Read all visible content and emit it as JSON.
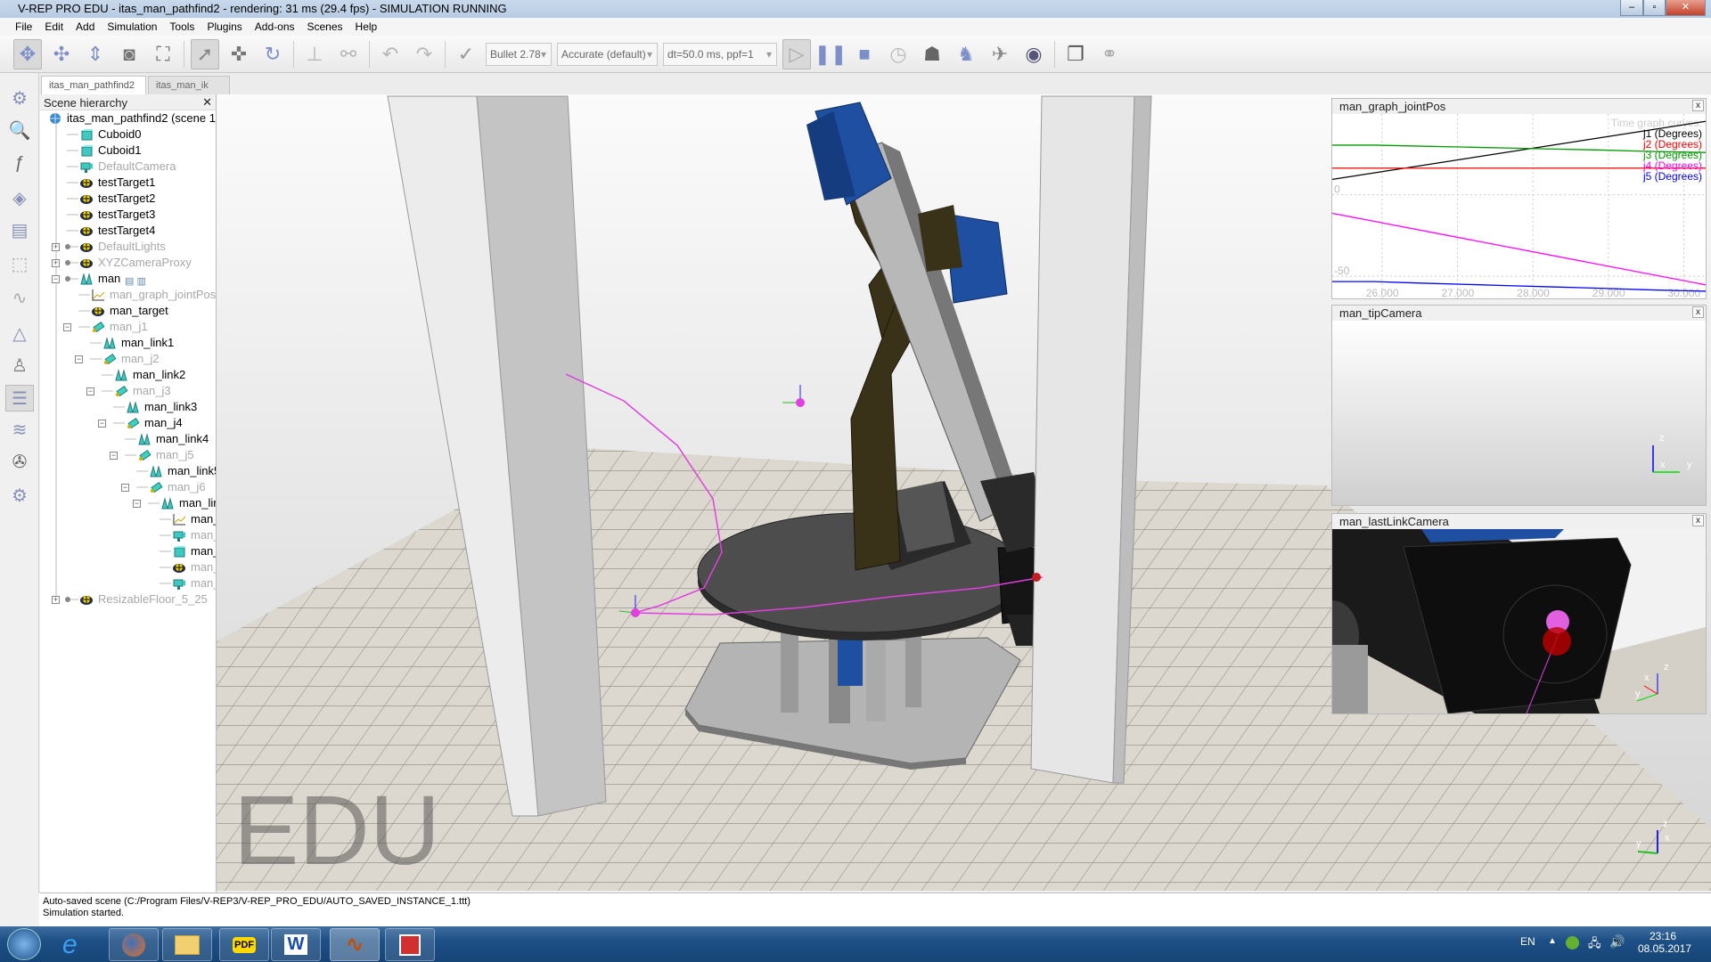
{
  "window": {
    "title": "V-REP PRO EDU - itas_man_pathfind2 - rendering: 31 ms (29.4 fps) - SIMULATION RUNNING",
    "min": "–",
    "max": "▫",
    "close": "✕"
  },
  "menu": [
    "File",
    "Edit",
    "Add",
    "Simulation",
    "Tools",
    "Plugins",
    "Add-ons",
    "Scenes",
    "Help"
  ],
  "toolbar": {
    "engine": "Bullet 2.78",
    "accuracy": "Accurate (default)",
    "timestep": "dt=50.0 ms, ppf=1",
    "icons": [
      "move-camera-icon",
      "rotate-camera-icon",
      "shift-camera-icon",
      "camera-angle-icon",
      "fit-to-view-icon",
      "click-select-icon",
      "object-shift-icon",
      "object-rotate-icon",
      "assemble-icon",
      "transfer-dna-icon",
      "undo-icon",
      "redo-icon",
      "dynamics-engine-icon",
      "start-simulation-icon",
      "pause-simulation-icon",
      "stop-simulation-icon",
      "real-time-icon",
      "slower-icon",
      "faster-icon",
      "thread-rendering-icon",
      "visualization-icon",
      "page-selector-icon",
      "scene-selector-icon"
    ]
  },
  "tabs": [
    {
      "label": "itas_man_pathfind2",
      "active": true
    },
    {
      "label": "itas_man_ik",
      "active": false
    }
  ],
  "hierarchy": {
    "title": "Scene hierarchy",
    "close": "✕",
    "items": [
      {
        "label": "itas_man_pathfind2 (scene 1)",
        "level": 0,
        "icon": "scene",
        "gray": false
      },
      {
        "label": "Cuboid0",
        "level": 1,
        "icon": "cuboid",
        "gray": false
      },
      {
        "label": "Cuboid1",
        "level": 1,
        "icon": "cuboid",
        "gray": false
      },
      {
        "label": "DefaultCamera",
        "level": 1,
        "icon": "camera",
        "gray": true
      },
      {
        "label": "testTarget1",
        "level": 1,
        "icon": "dummy",
        "gray": false
      },
      {
        "label": "testTarget2",
        "level": 1,
        "icon": "dummy",
        "gray": false
      },
      {
        "label": "testTarget3",
        "level": 1,
        "icon": "dummy",
        "gray": false
      },
      {
        "label": "testTarget4",
        "level": 1,
        "icon": "dummy",
        "gray": false
      },
      {
        "label": "DefaultLights",
        "level": 1,
        "icon": "dummy",
        "gray": true,
        "expander": "+"
      },
      {
        "label": "XYZCameraProxy",
        "level": 1,
        "icon": "dummy",
        "gray": true,
        "expander": "+"
      },
      {
        "label": "man",
        "level": 1,
        "icon": "shape",
        "gray": false,
        "expander": "−",
        "extras": true
      },
      {
        "label": "man_graph_jointPos",
        "level": 2,
        "icon": "graph",
        "gray": true
      },
      {
        "label": "man_target",
        "level": 2,
        "icon": "dummy",
        "gray": false
      },
      {
        "label": "man_j1",
        "level": 2,
        "icon": "joint",
        "gray": true,
        "expander": "−"
      },
      {
        "label": "man_link1",
        "level": 3,
        "icon": "shape",
        "gray": false
      },
      {
        "label": "man_j2",
        "level": 3,
        "icon": "joint",
        "gray": true,
        "expander": "−"
      },
      {
        "label": "man_link2",
        "level": 4,
        "icon": "shape",
        "gray": false
      },
      {
        "label": "man_j3",
        "level": 4,
        "icon": "joint",
        "gray": true,
        "expander": "−"
      },
      {
        "label": "man_link3",
        "level": 5,
        "icon": "shape",
        "gray": false
      },
      {
        "label": "man_j4",
        "level": 5,
        "icon": "joint",
        "gray": false,
        "expander": "−"
      },
      {
        "label": "man_link4",
        "level": 6,
        "icon": "shape",
        "gray": false
      },
      {
        "label": "man_j5",
        "level": 6,
        "icon": "joint",
        "gray": true,
        "expander": "−"
      },
      {
        "label": "man_link5",
        "level": 7,
        "icon": "shape",
        "gray": false
      },
      {
        "label": "man_j6",
        "level": 7,
        "icon": "joint",
        "gray": true,
        "expander": "−"
      },
      {
        "label": "man_lin",
        "level": 8,
        "icon": "shape",
        "gray": false,
        "expander": "−"
      },
      {
        "label": "man_",
        "level": 9,
        "icon": "graph",
        "gray": false
      },
      {
        "label": "man_",
        "level": 9,
        "icon": "camera",
        "gray": true
      },
      {
        "label": "man_",
        "level": 9,
        "icon": "cuboid",
        "gray": false
      },
      {
        "label": "man_",
        "level": 9,
        "icon": "dummy",
        "gray": true
      },
      {
        "label": "man_",
        "level": 9,
        "icon": "camera",
        "gray": true
      },
      {
        "label": "ResizableFloor_5_25",
        "level": 1,
        "icon": "dummy",
        "gray": true,
        "expander": "+"
      }
    ]
  },
  "scene": {
    "watermark": "EDU"
  },
  "graph_panel": {
    "title": "man_graph_jointPos",
    "close": "x",
    "legend_title": "Time graph curves:"
  },
  "chart_data": {
    "type": "line",
    "xlim": [
      25.34,
      30.29
    ],
    "ylim": [
      -63.6,
      49.5
    ],
    "xticks": [
      "26.000",
      "27.000",
      "28.000",
      "29.000",
      "30.000"
    ],
    "xtick_values": [
      26,
      27,
      28,
      29,
      30
    ],
    "yticks": [
      "0",
      "-50"
    ],
    "ytick_values": [
      0,
      -50
    ],
    "grid": true,
    "legend_placement": "top-right",
    "series": [
      {
        "name": "j1 (Degrees)",
        "color": "#000000",
        "x": [
          25.34,
          30.29
        ],
        "y": [
          9.4,
          45.0
        ]
      },
      {
        "name": "j2 (Degrees)",
        "color": "#ff0000",
        "x": [
          25.34,
          30.29
        ],
        "y": [
          16.3,
          16.3
        ]
      },
      {
        "name": "j3 (Degrees)",
        "color": "#009900",
        "x": [
          25.34,
          25.9,
          26.5,
          27.1,
          27.7,
          28.3,
          28.9,
          29.5,
          30.29
        ],
        "y": [
          30.4,
          30.4,
          29.8,
          29.2,
          28.6,
          28.0,
          27.4,
          26.6,
          25.9
        ]
      },
      {
        "name": "j4 (Degrees)",
        "color": "#ff00ff",
        "x": [
          25.34,
          30.29
        ],
        "y": [
          -11.4,
          -55.3
        ]
      },
      {
        "name": "j5 (Degrees)",
        "color": "#0000ff",
        "x": [
          25.34,
          25.9,
          26.5,
          27.1,
          27.7,
          28.3,
          28.9,
          29.5,
          30.29
        ],
        "y": [
          -53.3,
          -53.3,
          -54.2,
          -55.0,
          -55.8,
          -56.6,
          -57.4,
          -58.3,
          -59.2
        ]
      }
    ]
  },
  "tip_camera": {
    "title": "man_tipCamera",
    "close": "x",
    "axes": [
      "z",
      "x",
      "y"
    ]
  },
  "lastlink_camera": {
    "title": "man_lastLinkCamera",
    "close": "x",
    "axes": [
      "z",
      "x",
      "y"
    ]
  },
  "main_axes": [
    "z",
    "x",
    "y"
  ],
  "status": {
    "lines": [
      "Auto-saved scene (C:/Program Files/V-REP3/V-REP_PRO_EDU/AUTO_SAVED_INSTANCE_1.ttt)",
      "Simulation started."
    ]
  },
  "taskbar": {
    "apps": [
      "internet-explorer-icon",
      "firefox-icon",
      "file-explorer-icon",
      "pdf-reader-icon",
      "word-icon",
      "vrep-icon",
      "presentation-icon"
    ],
    "pdf": "PDF",
    "word": "W",
    "lang": "EN",
    "time": "23:16",
    "date": "08.05.2017"
  }
}
